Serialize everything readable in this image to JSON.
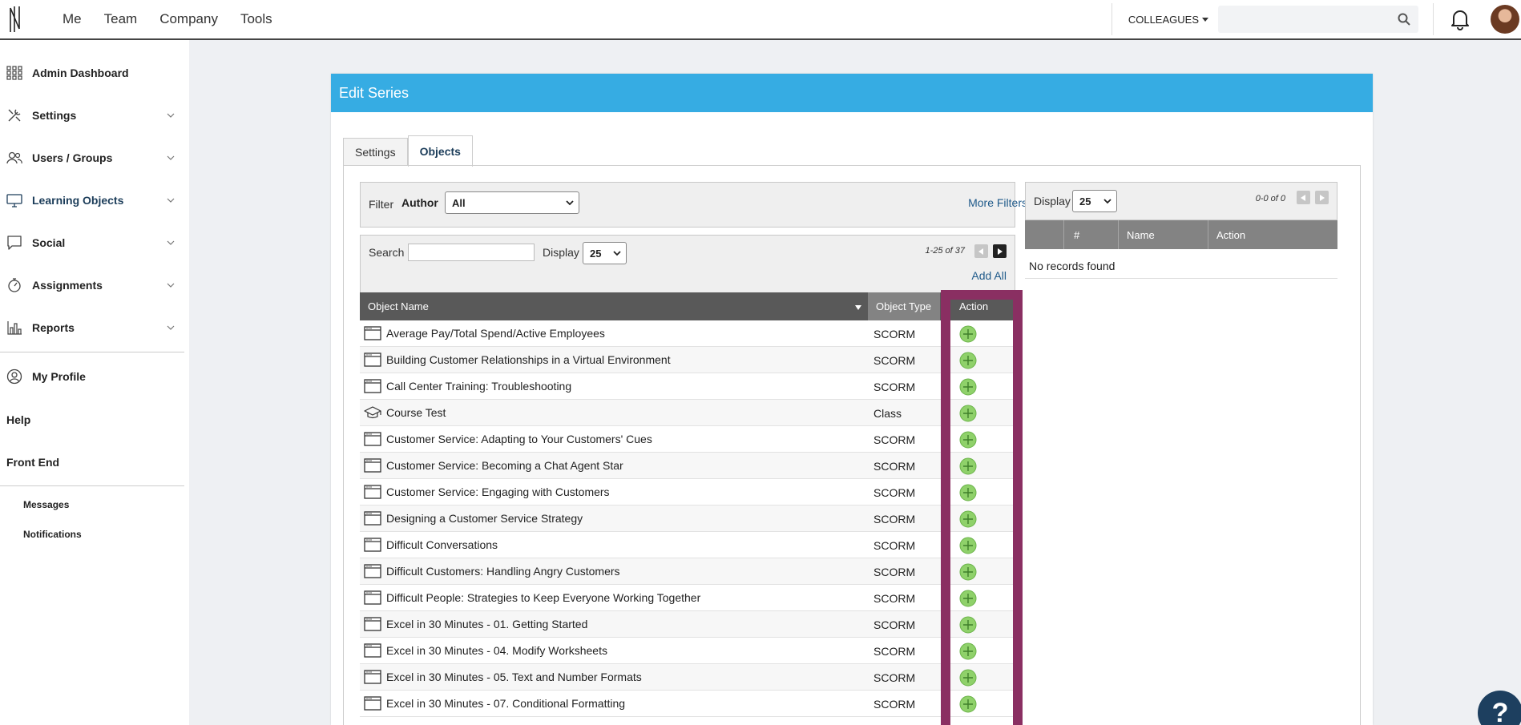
{
  "topnav": {
    "items": [
      "Me",
      "Team",
      "Company",
      "Tools"
    ],
    "colleagues_label": "COLLEAGUES",
    "search_placeholder": ""
  },
  "sidebar": {
    "items": [
      {
        "label": "Admin Dashboard",
        "icon": "grid-icon",
        "chevron": false
      },
      {
        "label": "Settings",
        "icon": "tools-icon",
        "chevron": true
      },
      {
        "label": "Users / Groups",
        "icon": "users-icon",
        "chevron": true
      },
      {
        "label": "Learning Objects",
        "icon": "monitor-icon",
        "chevron": true
      },
      {
        "label": "Social",
        "icon": "chat-icon",
        "chevron": true
      },
      {
        "label": "Assignments",
        "icon": "stopwatch-icon",
        "chevron": true
      },
      {
        "label": "Reports",
        "icon": "bar-chart-icon",
        "chevron": true
      },
      {
        "label": "My Profile",
        "icon": "profile-icon",
        "chevron": false
      }
    ],
    "links": [
      "Help",
      "Front End"
    ],
    "sub_links": [
      "Messages",
      "Notifications"
    ]
  },
  "panel": {
    "title": "Edit Series",
    "tabs": [
      "Settings",
      "Objects"
    ],
    "filter": {
      "label": "Filter",
      "author_label": "Author",
      "author_value": "All",
      "more_filters": "More Filters"
    },
    "search": {
      "label": "Search",
      "value": "",
      "display_label": "Display",
      "display_value": "25",
      "pager": "1-25 of 37",
      "add_all": "Add All"
    },
    "table": {
      "headers": {
        "name": "Object Name",
        "type": "Object Type",
        "action": "Action"
      },
      "rows": [
        {
          "name": "Average Pay/Total Spend/Active Employees",
          "type": "SCORM",
          "icon": "window-icon"
        },
        {
          "name": "Building Customer Relationships in a Virtual Environment",
          "type": "SCORM",
          "icon": "window-icon"
        },
        {
          "name": "Call Center Training: Troubleshooting",
          "type": "SCORM",
          "icon": "window-icon"
        },
        {
          "name": "Course Test",
          "type": "Class",
          "icon": "graduation-cap-icon"
        },
        {
          "name": "Customer Service: Adapting to Your Customers' Cues",
          "type": "SCORM",
          "icon": "window-icon"
        },
        {
          "name": "Customer Service: Becoming a Chat Agent Star",
          "type": "SCORM",
          "icon": "window-icon"
        },
        {
          "name": "Customer Service: Engaging with Customers",
          "type": "SCORM",
          "icon": "window-icon"
        },
        {
          "name": "Designing a Customer Service Strategy",
          "type": "SCORM",
          "icon": "window-icon"
        },
        {
          "name": "Difficult Conversations",
          "type": "SCORM",
          "icon": "window-icon"
        },
        {
          "name": "Difficult Customers: Handling Angry Customers",
          "type": "SCORM",
          "icon": "window-icon"
        },
        {
          "name": "Difficult People: Strategies to Keep Everyone Working Together",
          "type": "SCORM",
          "icon": "window-icon"
        },
        {
          "name": "Excel in 30 Minutes - 01. Getting Started",
          "type": "SCORM",
          "icon": "window-icon"
        },
        {
          "name": "Excel in 30 Minutes - 04. Modify Worksheets",
          "type": "SCORM",
          "icon": "window-icon"
        },
        {
          "name": "Excel in 30 Minutes - 05. Text and Number Formats",
          "type": "SCORM",
          "icon": "window-icon"
        },
        {
          "name": "Excel in 30 Minutes - 07. Conditional Formatting",
          "type": "SCORM",
          "icon": "window-icon"
        }
      ]
    },
    "selected": {
      "display_label": "Display",
      "display_value": "25",
      "pager": "0-0 of 0",
      "headers": {
        "num": "#",
        "name": "Name",
        "action": "Action"
      },
      "empty_text": "No records found"
    }
  },
  "help_label": "?",
  "colors": {
    "header_blue": "#36ace3",
    "highlight": "#8a2f62",
    "add_green": "#8fd16a"
  }
}
